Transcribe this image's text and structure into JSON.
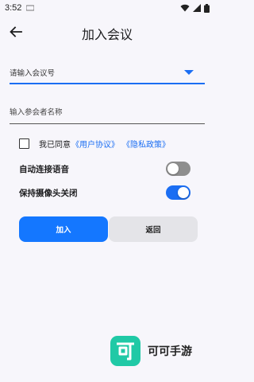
{
  "status_bar": {
    "time": "3:52"
  },
  "header": {
    "title": "加入会议"
  },
  "form": {
    "meeting_id_placeholder": "请输入会议号",
    "name_placeholder": "输入参会者名称"
  },
  "agreement": {
    "text": "我已同意",
    "user_agreement": "《用户协议》",
    "privacy_policy": "《隐私政策》",
    "checked": false
  },
  "options": {
    "auto_audio_label": "自动连接语音",
    "auto_audio_on": false,
    "keep_camera_off_label": "保持摄像头关闭",
    "keep_camera_off_on": true
  },
  "buttons": {
    "join": "加入",
    "back": "返回"
  },
  "watermark": {
    "logo_char": "可",
    "brand": "可可手游"
  },
  "colors": {
    "accent": "#1b6ef3",
    "primary_button": "#1477ff",
    "logo": "#20c9a6"
  }
}
